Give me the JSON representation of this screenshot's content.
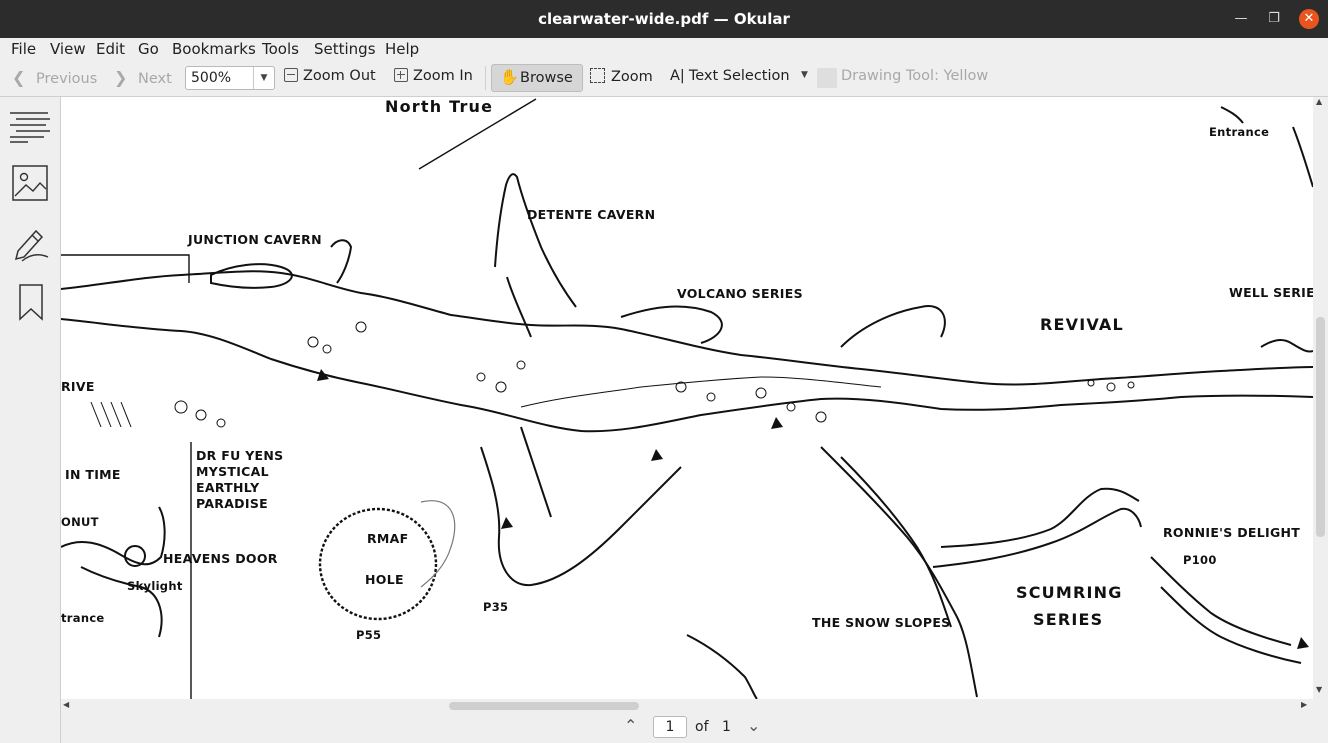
{
  "window": {
    "title": "clearwater-wide.pdf — Okular"
  },
  "menu": [
    "File",
    "View",
    "Edit",
    "Go",
    "Bookmarks",
    "Tools",
    "Settings",
    "Help"
  ],
  "toolbar": {
    "previous": "Previous",
    "next": "Next",
    "zoom_value": "500%",
    "zoom_out": "Zoom Out",
    "zoom_in": "Zoom In",
    "browse": "Browse",
    "zoom": "Zoom",
    "text_selection": "Text Selection",
    "drawing_tool": "Drawing Tool: Yellow"
  },
  "sidebar": {
    "icons": [
      "contents-icon",
      "thumbnails-icon",
      "annotations-icon",
      "bookmarks-icon"
    ]
  },
  "map": {
    "labels": {
      "north": "North True",
      "entrance": "Entrance",
      "detente": "DETENTE CAVERN",
      "junction": "JUNCTION CAVERN",
      "volcano": "VOLCANO SERIES",
      "well": "WELL SERIE",
      "revival": "REVIVAL",
      "rive": "RIVE",
      "in_time": "IN TIME",
      "drfu1": "DR FU YENS",
      "drfu2": "MYSTICAL",
      "drfu3": "EARTHLY",
      "drfu4": "PARADISE",
      "onut": "ONUT",
      "heavens": "HEAVENS DOOR",
      "skylight": "Skylight",
      "trance": "trance",
      "rmaf": "RMAF",
      "hole": "HOLE",
      "p55": "P55",
      "p35": "P35",
      "ronnie": "RONNIE'S DELIGHT",
      "p100": "P100",
      "scumring1": "SCUMRING",
      "scumring2": "SERIES",
      "snow": "THE SNOW SLOPES"
    }
  },
  "pager": {
    "current": "1",
    "of_label": "of",
    "total": "1"
  }
}
